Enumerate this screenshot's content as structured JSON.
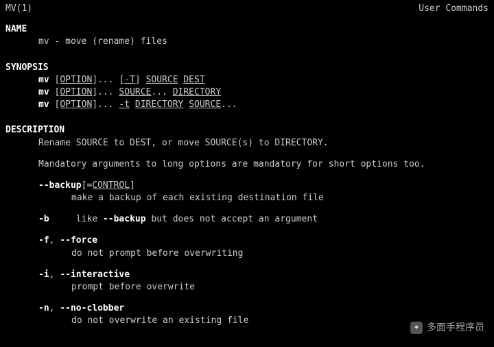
{
  "header": {
    "left": "MV(1)",
    "right": "User Commands"
  },
  "sections": {
    "name_label": "NAME",
    "name_text": "mv - move (rename) files",
    "synopsis_label": "SYNOPSIS",
    "syn": {
      "mv": "mv",
      "option": "OPTION",
      "T": "-T",
      "source": "SOURCE",
      "dest": "DEST",
      "directory": "DIRECTORY",
      "t": "-t",
      "dots": "...",
      "lb": "[",
      "rb": "]"
    },
    "description_label": "DESCRIPTION",
    "desc_line1": "Rename SOURCE to DEST, or move SOURCE(s) to DIRECTORY.",
    "desc_line2": "Mandatory arguments to long options are mandatory for short options too.",
    "opts": {
      "backup_flag": "--backup",
      "backup_eq": "[=",
      "backup_ctrl": "CONTROL",
      "backup_rb": "]",
      "backup_desc": "make a backup of each existing destination file",
      "b_flag": "-b",
      "b_pre": "like ",
      "b_ref": "--backup",
      "b_post": " but does not accept an argument",
      "f_flag": "-f",
      "force_flag": "--force",
      "force_desc": "do not prompt before overwriting",
      "i_flag": "-i",
      "inter_flag": "--interactive",
      "inter_desc": "prompt before overwrite",
      "n_flag": "-n",
      "noclob_flag": "--no-clobber",
      "noclob_desc": "do not overwrite an existing file",
      "comma": ", "
    }
  },
  "watermark": {
    "icon": "✦",
    "text": "多面手程序员"
  }
}
